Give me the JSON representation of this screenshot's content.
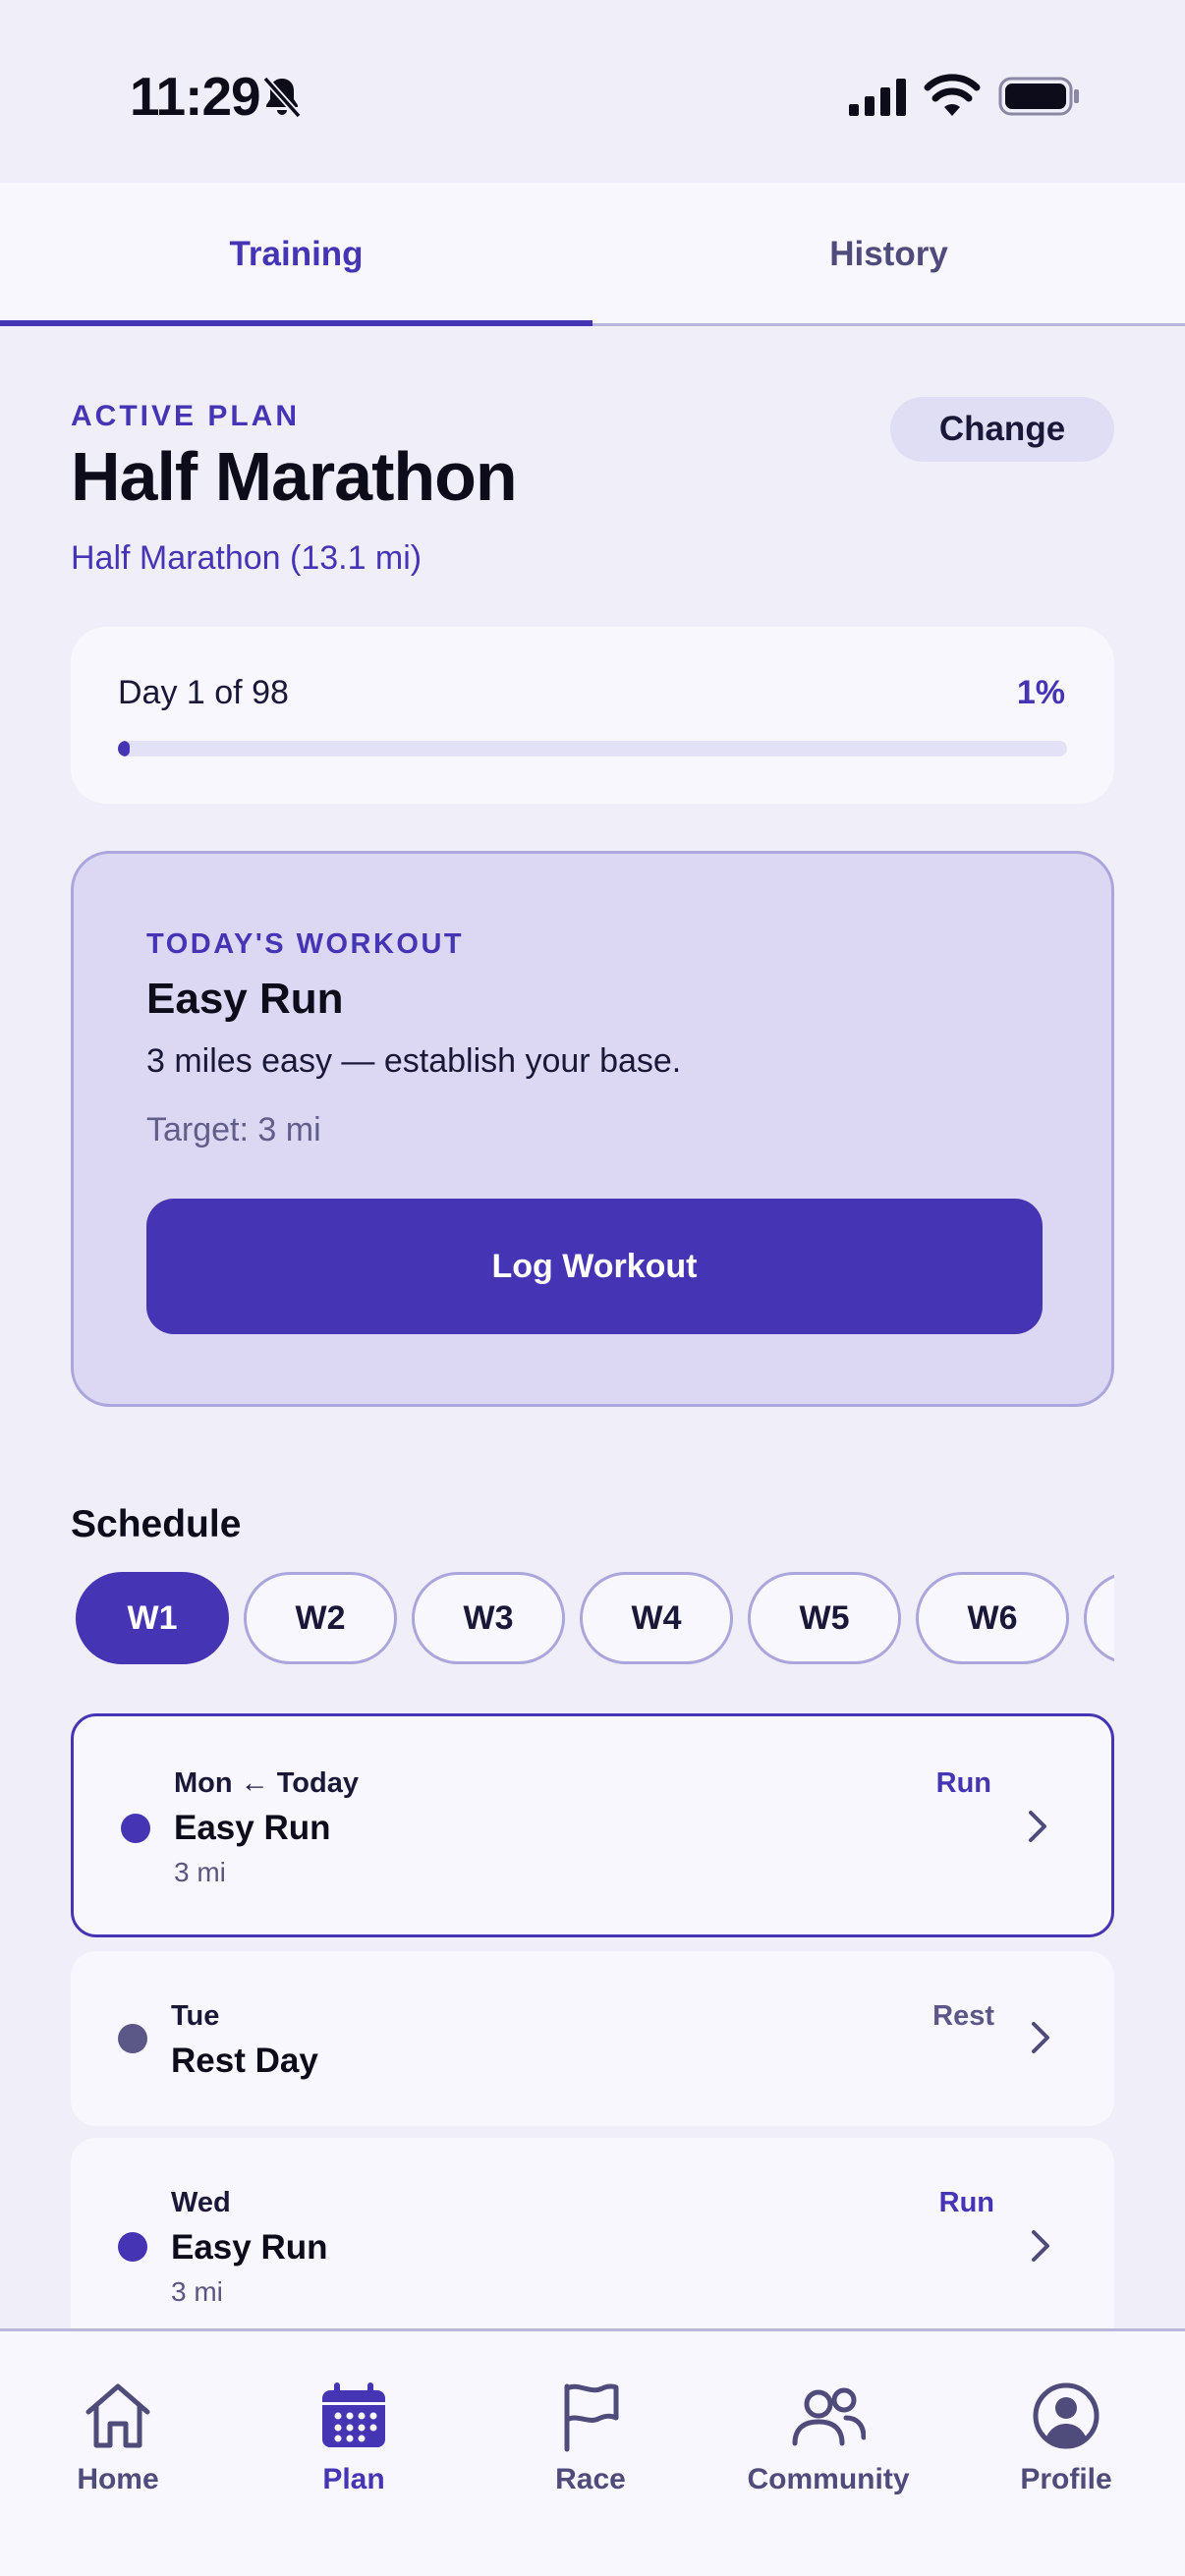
{
  "status_bar": {
    "time": "11:29"
  },
  "tabs": [
    {
      "label": "Training",
      "active": true
    },
    {
      "label": "History",
      "active": false
    }
  ],
  "plan": {
    "eyebrow": "ACTIVE PLAN",
    "title": "Half Marathon",
    "subtitle": "Half Marathon (13.1 mi)",
    "change_label": "Change"
  },
  "progress": {
    "day_text": "Day 1 of 98",
    "percent_text": "1%",
    "fraction": 0.01
  },
  "today": {
    "eyebrow": "TODAY'S WORKOUT",
    "title": "Easy Run",
    "description": "3 miles easy — establish your base.",
    "target": "Target: 3 mi",
    "button_label": "Log Workout"
  },
  "schedule": {
    "title": "Schedule",
    "weeks": [
      "W1",
      "W2",
      "W3",
      "W4",
      "W5",
      "W6"
    ],
    "active_week": "W1",
    "days": [
      {
        "day": "Mon ← Today",
        "title": "Easy Run",
        "distance": "3 mi",
        "type": "Run",
        "today": true
      },
      {
        "day": "Tue",
        "title": "Rest Day",
        "distance": "",
        "type": "Rest",
        "today": false
      },
      {
        "day": "Wed",
        "title": "Easy Run",
        "distance": "3 mi",
        "type": "Run",
        "today": false
      }
    ]
  },
  "nav": [
    {
      "label": "Home",
      "icon": "home-icon",
      "active": false
    },
    {
      "label": "Plan",
      "icon": "calendar-icon",
      "active": true
    },
    {
      "label": "Race",
      "icon": "flag-icon",
      "active": false
    },
    {
      "label": "Community",
      "icon": "community-icon",
      "active": false
    },
    {
      "label": "Profile",
      "icon": "profile-icon",
      "active": false
    }
  ],
  "colors": {
    "accent": "#4535b4",
    "background": "#efeef9",
    "card": "#f8f7fe",
    "workout_card": "#dcd8f3"
  }
}
